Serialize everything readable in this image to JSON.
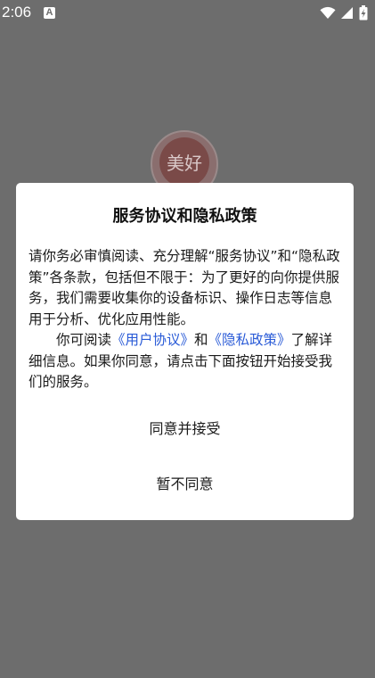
{
  "status_bar": {
    "time": "2:06",
    "notification_glyph": "A",
    "icons": [
      "wifi-icon",
      "signal-icon",
      "battery-icon"
    ]
  },
  "background": {
    "logo_text": "美好"
  },
  "dialog": {
    "title": "服务协议和隐私政策",
    "paragraph1": "请你务必审慎阅读、充分理解“服务协议”和“隐私政策”各条款，包括但不限于：为了更好的向你提供服务，我们需要收集你的设备标识、操作日志等信息用于分析、优化应用性能。",
    "paragraph2_prefix": "你可阅读",
    "user_agreement_link": "《用户协议》",
    "and_text": "和",
    "privacy_policy_link": "《隐私政策》",
    "paragraph2_suffix": "了解详细信息。如果你同意，请点击下面按钮开始接受我们的服务。",
    "accept_label": "同意并接受",
    "decline_label": "暂不同意"
  },
  "colors": {
    "overlay": "#6d6d6d",
    "link": "#2a5bd7",
    "logo_red": "#c8322d"
  }
}
